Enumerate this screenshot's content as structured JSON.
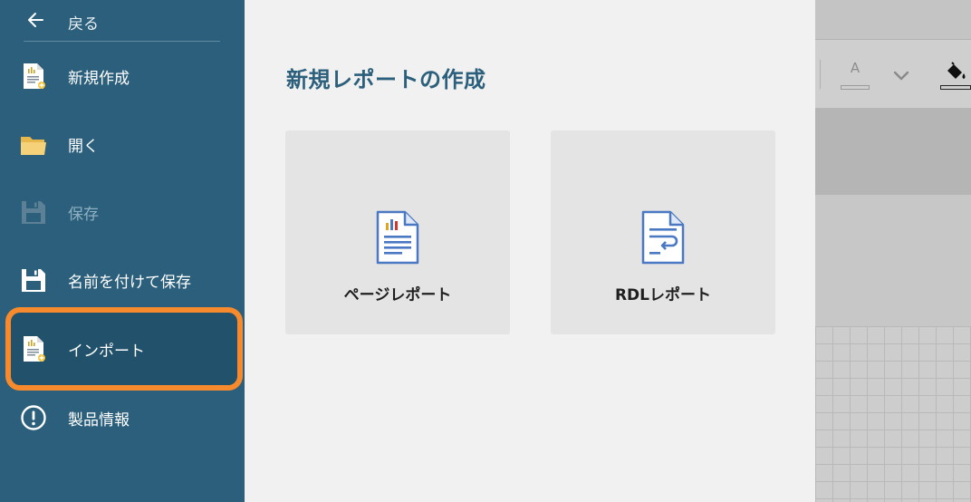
{
  "sidebar": {
    "back": {
      "label": "戻る",
      "icon": "arrow-left-icon"
    },
    "items": [
      {
        "id": "new",
        "label": "新規作成",
        "icon": "new-document-icon",
        "disabled": false,
        "selected": false
      },
      {
        "id": "open",
        "label": "開く",
        "icon": "folder-icon",
        "disabled": false,
        "selected": false
      },
      {
        "id": "save",
        "label": "保存",
        "icon": "floppy-disk-icon",
        "disabled": true,
        "selected": false
      },
      {
        "id": "save-as",
        "label": "名前を付けて保存",
        "icon": "floppy-disk-icon",
        "disabled": false,
        "selected": false
      },
      {
        "id": "import",
        "label": "インポート",
        "icon": "import-document-icon",
        "disabled": false,
        "selected": true
      },
      {
        "id": "about",
        "label": "製品情報",
        "icon": "info-circle-icon",
        "disabled": false,
        "selected": false
      }
    ],
    "colors": {
      "background": "#2b5f7b",
      "selected_background": "#21516b",
      "highlight_ring": "#f68a2c"
    }
  },
  "main": {
    "title": "新規レポートの作成",
    "cards": [
      {
        "label": "ページレポート",
        "icon": "page-report-icon"
      },
      {
        "label": "RDLレポート",
        "icon": "rdl-report-icon"
      }
    ],
    "colors": {
      "title": "#2b5f7b",
      "card_background": "#e4e4e4"
    }
  },
  "editor": {
    "font_color_button": {
      "glyph": "A",
      "icon": "font-color-icon"
    },
    "dropdown_icon": "chevron-down-icon",
    "fill_icon": "paint-bucket-icon"
  }
}
